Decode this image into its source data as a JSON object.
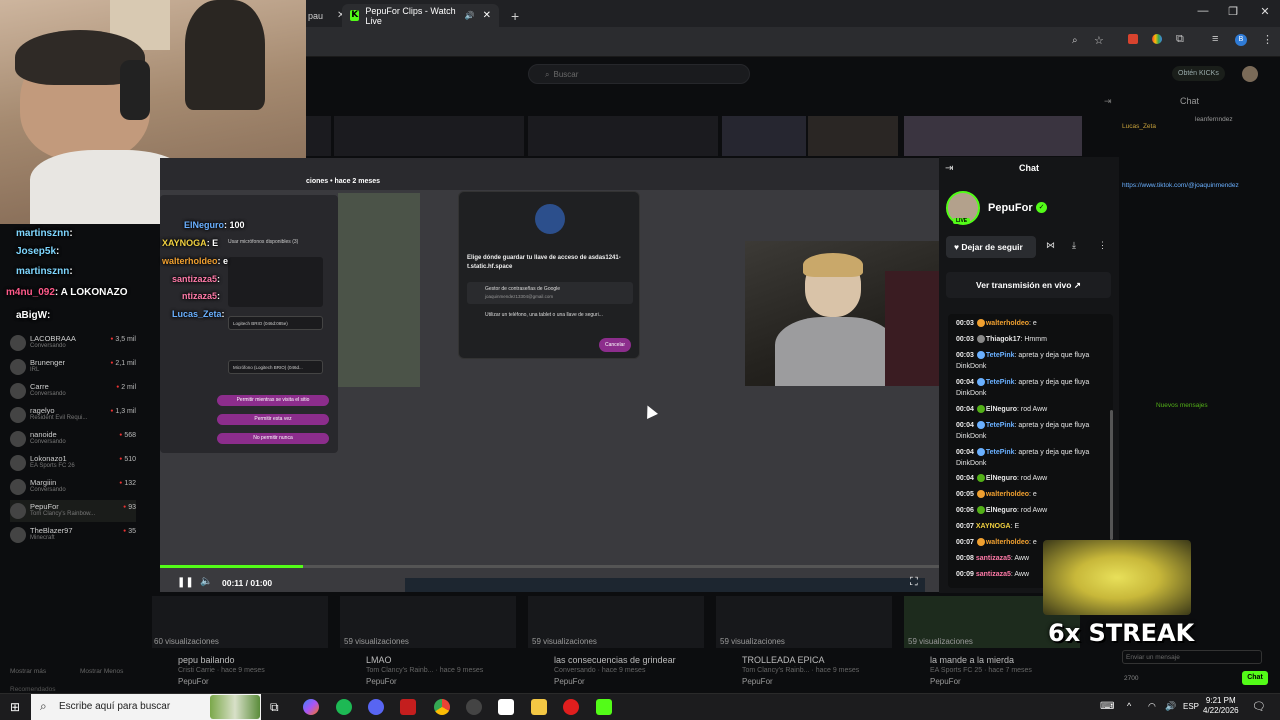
{
  "browser": {
    "tab_partial": "pau",
    "tab_active": "PepuFor Clips - Watch Live",
    "new_tab": "+",
    "close_glyph": "✕"
  },
  "page": {
    "search_placeholder": "Buscar",
    "get_kicks": "Obtén KICKs",
    "bg_chat_title": "Chat",
    "bg_chat_user": "Lucas_Zeta",
    "bg_chat_user2": "leanfernndez",
    "bg_chat_link": "https://www.tiktok.com/@joaquinmendez",
    "bg_new_messages": "Nuevos mensajes"
  },
  "sidebar": {
    "items": [
      {
        "name": "LACOBRAAA",
        "sub": "Conversando",
        "count": "3,5 mil"
      },
      {
        "name": "Brunenger",
        "sub": "IRL",
        "count": "2,1 mil"
      },
      {
        "name": "Carre",
        "sub": "Conversando",
        "count": "2 mil"
      },
      {
        "name": "ragelyo",
        "sub": "Resident Evil Requi...",
        "count": "1,3 mil"
      },
      {
        "name": "nanoide",
        "sub": "Conversando",
        "count": "568"
      },
      {
        "name": "Lokonazo1",
        "sub": "EA Sports FC 26",
        "count": "510"
      },
      {
        "name": "Margiiin",
        "sub": "Conversando",
        "count": "132"
      },
      {
        "name": "PepuFor",
        "sub": "Tom Clancy's Rainbow...",
        "count": "93"
      },
      {
        "name": "TheBlazer97",
        "sub": "Minecraft",
        "count": "35"
      }
    ],
    "show_more": "Mostrar más",
    "show_less": "Mostrar Menos",
    "recommended": "Recomendados"
  },
  "overlay_chat": [
    {
      "user": "martinsznn",
      "text": ":"
    },
    {
      "user": "Josep5k",
      "text": ":"
    },
    {
      "user": "martinsznn",
      "text": ":"
    },
    {
      "user": "m4nu_092",
      "text": ": A LOKONAZO"
    },
    {
      "user": "aBigW",
      "text": ":"
    }
  ],
  "overlay_chat2": [
    {
      "user": "ElNeguro",
      "text": ": 100"
    },
    {
      "user": "XAYNOGA",
      "text": ": E"
    },
    {
      "user": "walterholdeo",
      "text": ": e"
    },
    {
      "user": "santizaza5",
      "text": ":"
    },
    {
      "user": "ntizaza5",
      "text": ":"
    },
    {
      "user": "Lucas_Zeta",
      "text": ":"
    }
  ],
  "video": {
    "title_fragment": "ciones • hace 2 meses",
    "pw_dialog_title": "Elige dónde guardar tu llave de acceso de asdas1241-t.static.hf.space",
    "pw_option1": "Gestor de contraseñas de Google",
    "pw_option1_sub": "joaquinmendez13304@gmail.com",
    "pw_option2": "Utilizar un teléfono, una tablet o una llave de seguri...",
    "pw_cancel": "Cancelar",
    "perm_cam": "Logitech BRIO (046d:085e)",
    "perm_mic": "Micrófono (Logitech BRIO) (046d...",
    "perm_allow_always": "Permitir mientras se visita el sitio",
    "perm_allow_once": "Permitir esta vez",
    "perm_deny": "No permitir nunca",
    "perm_cams_available": "Usar micrófonos disponibles (3)",
    "progress_percent": 18.3,
    "timecode": "00:11 / 01:00"
  },
  "chat": {
    "title": "Chat",
    "channel_name": "PepuFor",
    "live_badge": "LIVE",
    "unfollow": "Dejar de seguir",
    "watch_live": "Ver transmisión en vivo",
    "messages": [
      {
        "time": "00:03",
        "user": "walterholdeo",
        "text": ": e",
        "color": "#f0a030"
      },
      {
        "time": "00:03",
        "user": "Thiagok17",
        "text": ": Hmmm",
        "color": "#e6e6e6"
      },
      {
        "time": "00:03",
        "user": "TetePink",
        "text": ": apreta y deja que fluya DinkDonk",
        "color": "#6ab0ff"
      },
      {
        "time": "00:04",
        "user": "TetePink",
        "text": ": apreta y deja que fluya DinkDonk",
        "color": "#6ab0ff"
      },
      {
        "time": "00:04",
        "user": "ElNeguro",
        "text": ": rod Aww",
        "color": "#e6e6e6"
      },
      {
        "time": "00:04",
        "user": "TetePink",
        "text": ": apreta y deja que fluya DinkDonk",
        "color": "#6ab0ff"
      },
      {
        "time": "00:04",
        "user": "TetePink",
        "text": ": apreta y deja que fluya DinkDonk",
        "color": "#6ab0ff"
      },
      {
        "time": "00:04",
        "user": "ElNeguro",
        "text": ": rod Aww",
        "color": "#e6e6e6"
      },
      {
        "time": "00:05",
        "user": "walterholdeo",
        "text": ": e",
        "color": "#f0a030"
      },
      {
        "time": "00:06",
        "user": "ElNeguro",
        "text": ": rod Aww",
        "color": "#e6e6e6"
      },
      {
        "time": "00:07",
        "user": "XAYNOGA",
        "text": ": E",
        "color": "#f0d040"
      },
      {
        "time": "00:07",
        "user": "walterholdeo",
        "text": ": e",
        "color": "#f0a030"
      },
      {
        "time": "00:08",
        "user": "santizaza5",
        "text": ": Aww",
        "color": "#ff7aa8"
      },
      {
        "time": "00:09",
        "user": "santizaza5",
        "text": ": Aww",
        "color": "#ff7aa8"
      }
    ]
  },
  "streak": "6x STREAK",
  "bg_thumbs": [
    {
      "views": "60 visualizaciones",
      "title": "pepu bailando",
      "cat": "Cristi Carrie · hace 9 meses",
      "ch": "PepuFor"
    },
    {
      "views": "59 visualizaciones",
      "title": "LMAO",
      "cat": "Tom Clancy's Rainb... · hace 9 meses",
      "ch": "PepuFor"
    },
    {
      "views": "59 visualizaciones",
      "title": "las consecuencias de grindear",
      "cat": "Conversando · hace 9 meses",
      "ch": "PepuFor"
    },
    {
      "views": "59 visualizaciones",
      "title": "TROLLEADA EPICA",
      "cat": "Tom Clancy's Rainb... · hace 9 meses",
      "ch": "PepuFor"
    },
    {
      "views": "59 visualizaciones",
      "title": "la mande a la mierda",
      "cat": "EA Sports FC 25 · hace 7 meses",
      "ch": "PepuFor"
    }
  ],
  "taskbar": {
    "search_placeholder": "Escribe aquí para buscar",
    "lang": "ESP",
    "time": "9:21 PM",
    "date": "4/22/2026"
  },
  "bg_chat_actions": {
    "count": "2700",
    "send": "Chat",
    "input_placeholder": "Enviar un mensaje"
  }
}
